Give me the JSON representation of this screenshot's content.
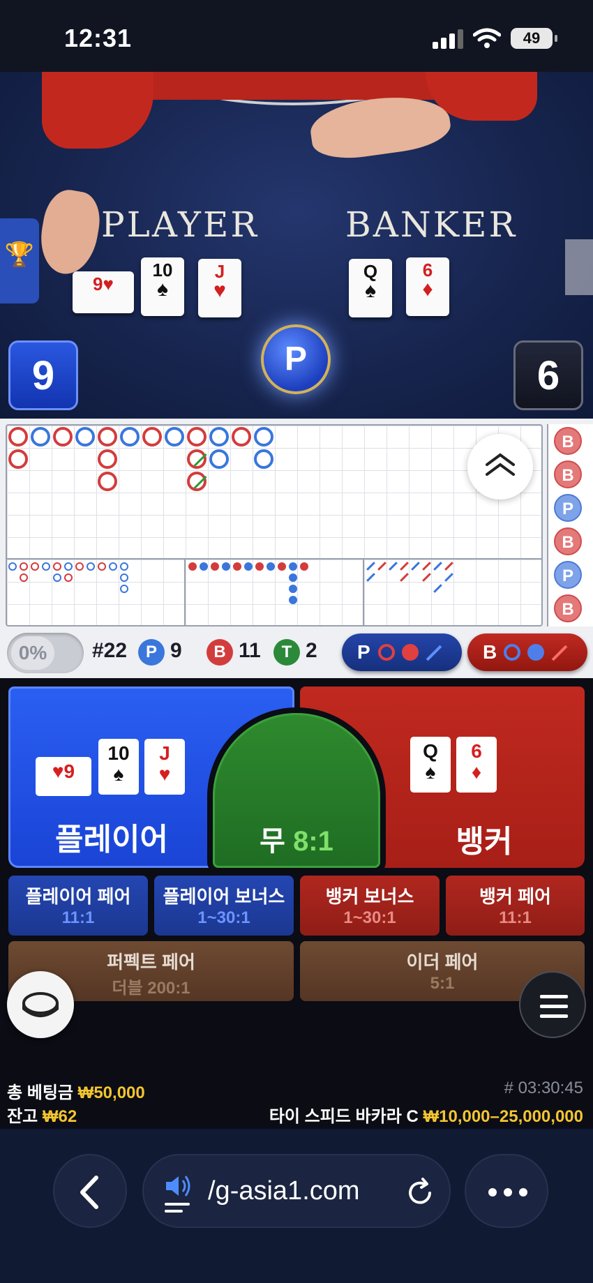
{
  "status": {
    "time": "12:31",
    "battery": "49"
  },
  "video": {
    "player_label": "PLAYER",
    "banker_label": "BANKER",
    "player_score": "9",
    "banker_score": "6",
    "winner": "P",
    "player_cards": [
      {
        "rank": "9",
        "suit": "♥",
        "color": "red"
      },
      {
        "rank": "10",
        "suit": "♠",
        "color": "black"
      },
      {
        "rank": "J",
        "suit": "♥",
        "color": "red"
      }
    ],
    "banker_cards": [
      {
        "rank": "Q",
        "suit": "♠",
        "color": "black"
      },
      {
        "rank": "6",
        "suit": "♦",
        "color": "red"
      }
    ],
    "trophy_icon": "🏆"
  },
  "roadmap": {
    "side_beads": [
      "B",
      "B",
      "P",
      "B",
      "P",
      "B"
    ]
  },
  "stats": {
    "pct_toggle": "0%",
    "round": "#22",
    "p_label": "P",
    "p_count": "9",
    "b_label": "B",
    "b_count": "11",
    "t_label": "T",
    "t_count": "2",
    "predict_p": "P",
    "predict_b": "B"
  },
  "bets": {
    "player": "플레이어",
    "tie": "무",
    "tie_odds": "8:1",
    "banker": "뱅커",
    "player_pair": "플레이어 페어",
    "player_pair_odds": "11:1",
    "player_bonus": "플레이어 보너스",
    "player_bonus_odds": "1~30:1",
    "banker_bonus": "뱅커 보너스",
    "banker_bonus_odds": "1~30:1",
    "banker_pair": "뱅커 페어",
    "banker_pair_odds": "11:1",
    "perfect_pair": "퍼펙트 페어",
    "perfect_pair_odds": "더블 200:1",
    "either_pair": "이더 페어",
    "either_pair_odds": "5:1"
  },
  "footer": {
    "total_bet_label": "총 베팅금",
    "total_bet_value": "₩50,000",
    "balance_label": "잔고",
    "balance_value": "₩62",
    "game_id": "# 03:30:45",
    "table_name": "타이 스피드 바카라 C",
    "limits": "₩10,000–25,000,000"
  },
  "browser": {
    "url": "/g-asia1.com"
  },
  "colors": {
    "player_blue": "#1a44d6",
    "banker_red": "#a71f17",
    "tie_green": "#1f6d23",
    "gold": "#f3c531"
  }
}
